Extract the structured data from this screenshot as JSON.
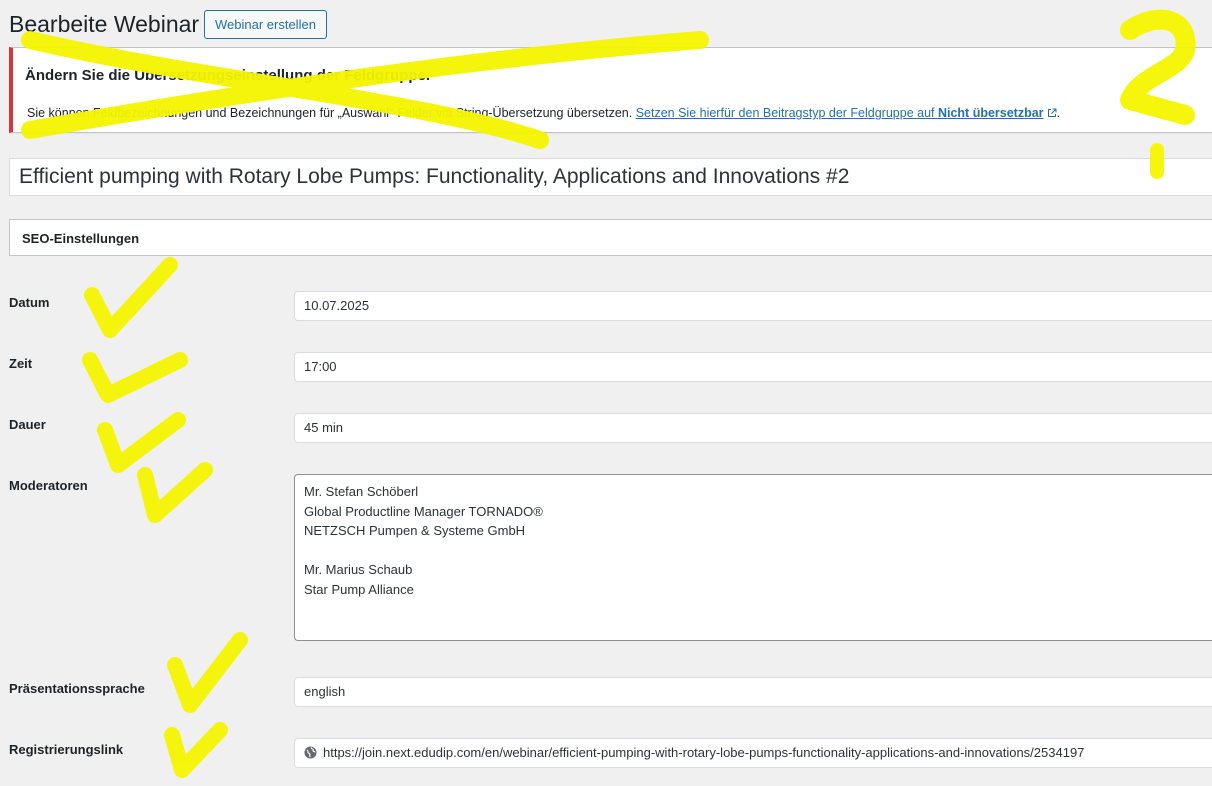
{
  "header": {
    "title": "Bearbeite Webinar",
    "add_button_label": "Webinar erstellen"
  },
  "notice": {
    "title": "Ändern Sie die Übersetzungseinstellung der Feldgruppe.",
    "text": "Sie können Feldbezeichnungen und Bezeichnungen für „Auswahl“-Felder via String-Übersetzung übersetzen. ",
    "link_text": "Setzen Sie hierfür den Beitragstyp der Feldgruppe auf ",
    "link_bold": "Nicht übersetzbar",
    "text_end": "."
  },
  "post_title": "Efficient pumping with Rotary Lobe Pumps: Functionality, Applications and Innovations #2",
  "seo_box_label": "SEO-Einstellungen",
  "fields": {
    "datum": {
      "label": "Datum",
      "value": "10.07.2025"
    },
    "zeit": {
      "label": "Zeit",
      "value": "17:00"
    },
    "dauer": {
      "label": "Dauer",
      "value": "45 min"
    },
    "moderatoren": {
      "label": "Moderatoren",
      "lines": [
        "Mr. Stefan Schöberl",
        "Global Productline Manager TORNADO®",
        "NETZSCH Pumpen & Systeme GmbH",
        "",
        "Mr. Marius Schaub",
        "Star Pump Alliance"
      ]
    },
    "sprache": {
      "label": "Präsentationssprache",
      "value": "english"
    },
    "registrierung": {
      "label": "Registrierungslink",
      "value": "https://join.next.edudip.com/en/webinar/efficient-pumping-with-rotary-lobe-pumps-functionality-applications-and-innovations/2534197"
    }
  },
  "colors": {
    "accent": "#2271b1",
    "error": "#d63638",
    "highlighter": "#f5f500"
  },
  "icons": {
    "external_link": "external-link-icon",
    "globe": "globe-icon"
  }
}
